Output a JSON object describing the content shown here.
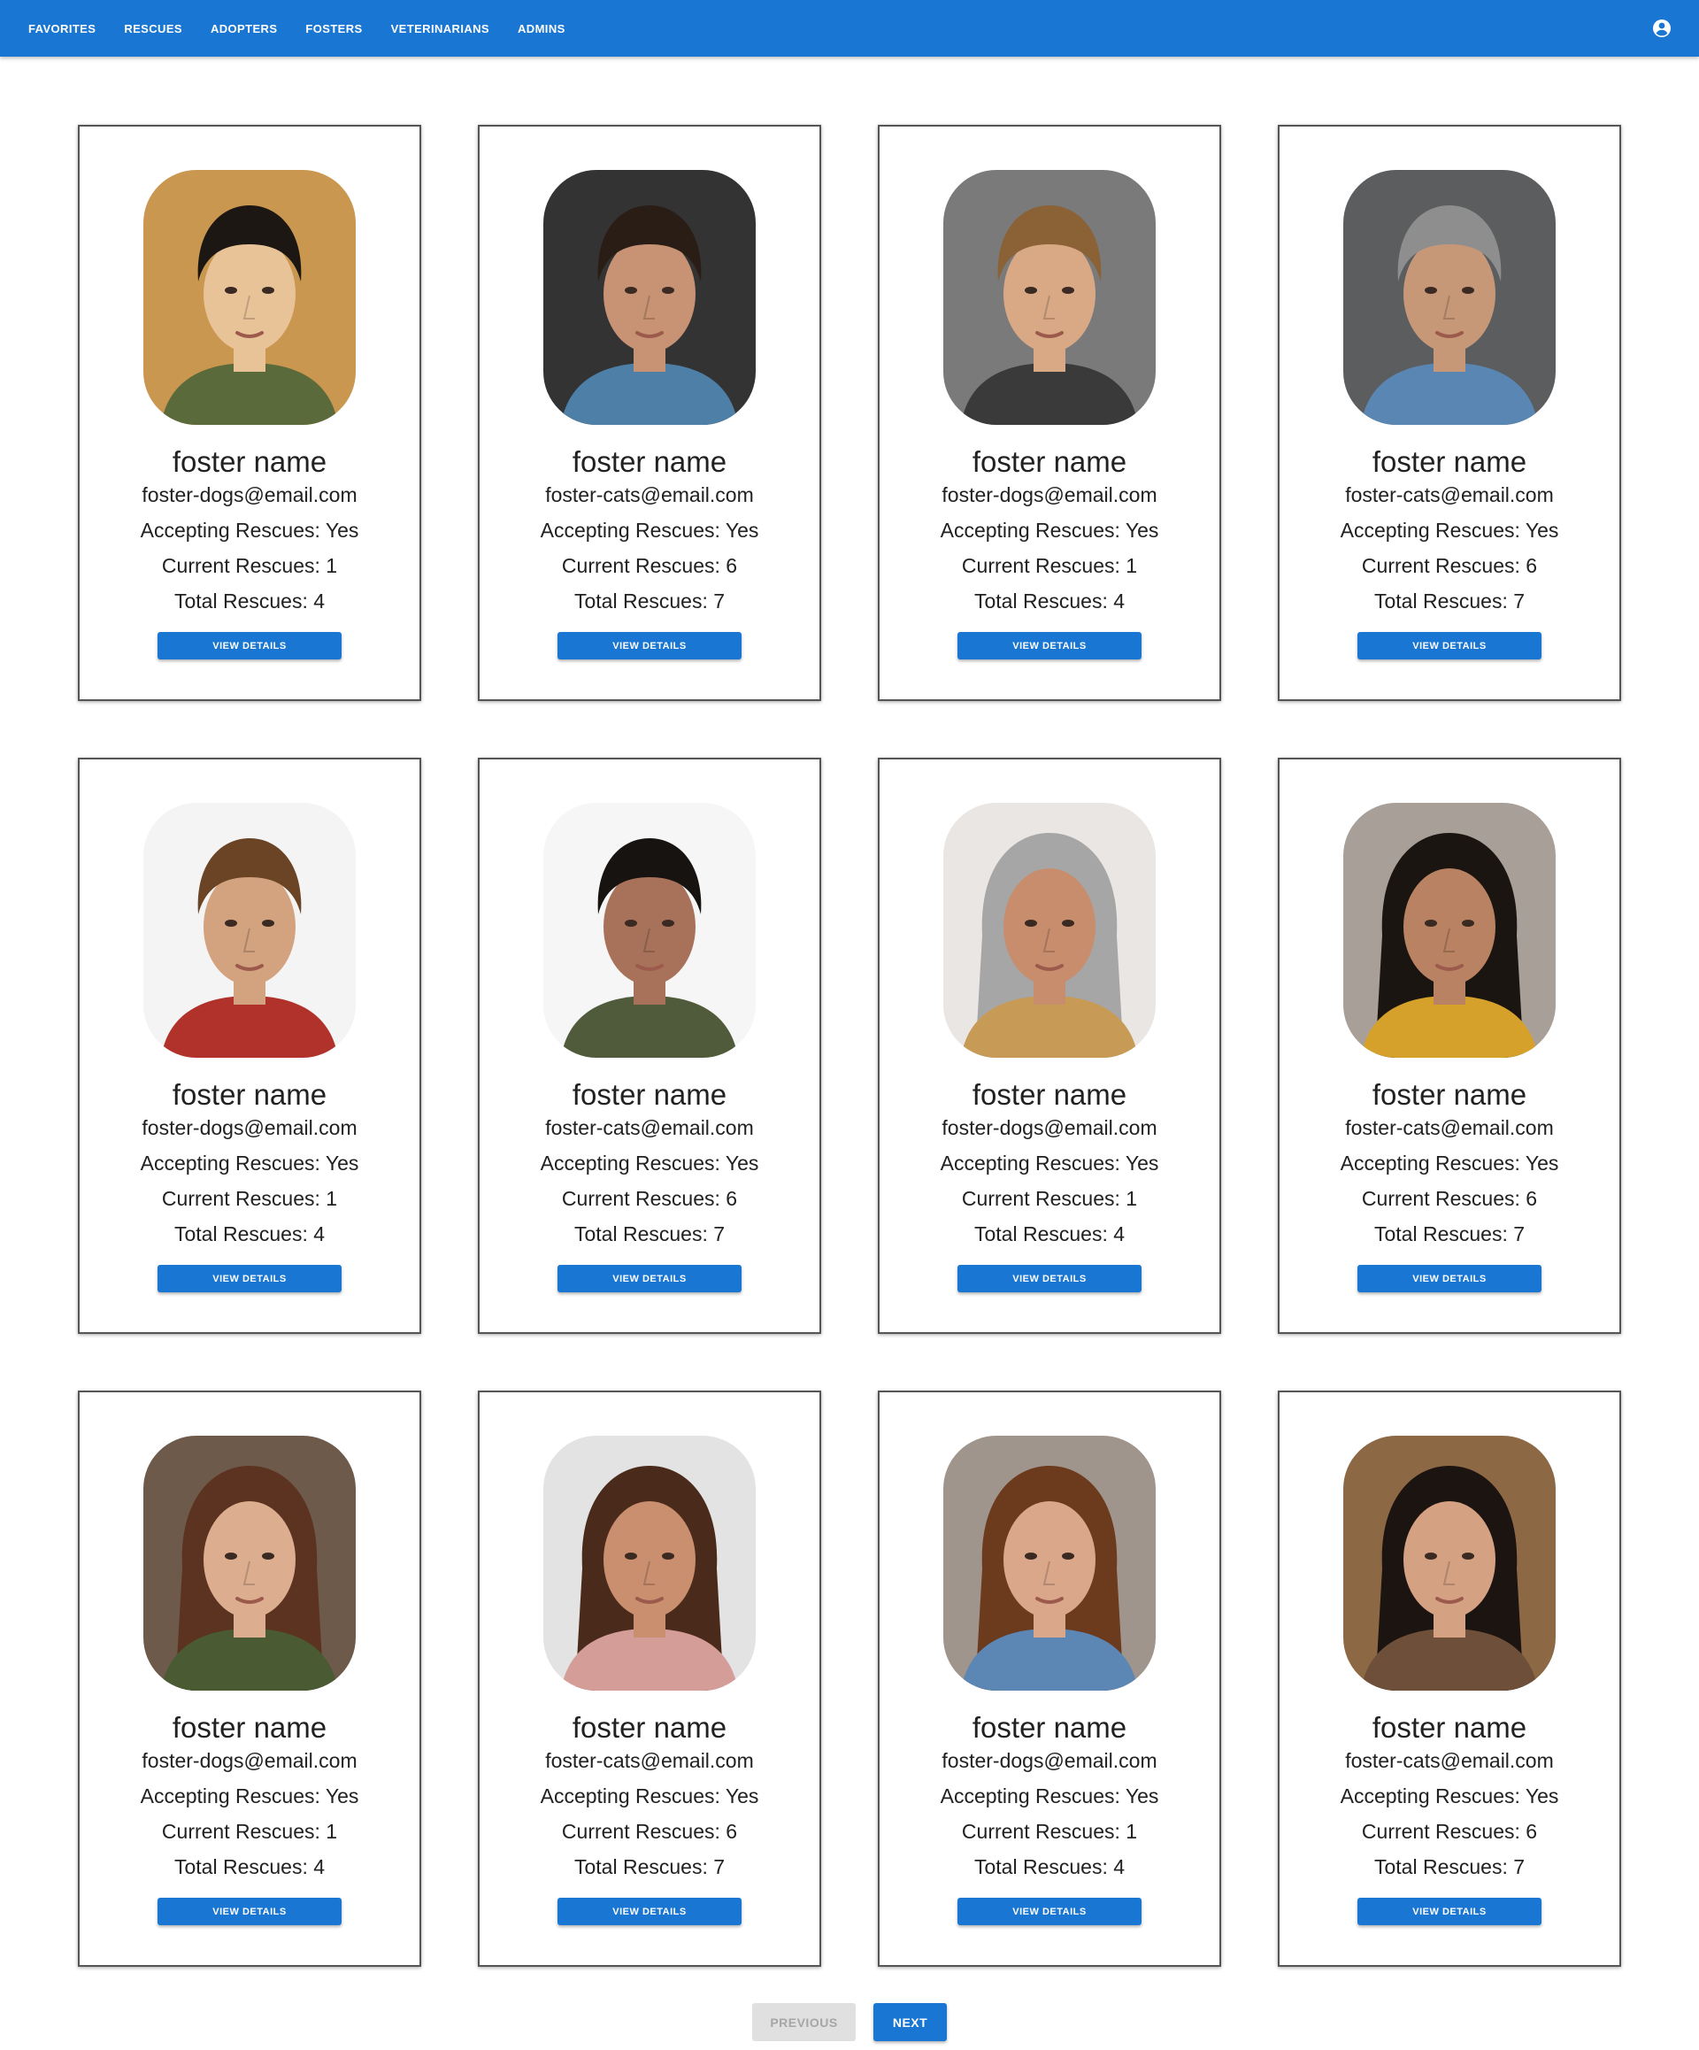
{
  "nav": {
    "items": [
      {
        "label": "FAVORITES"
      },
      {
        "label": "RESCUES"
      },
      {
        "label": "ADOPTERS"
      },
      {
        "label": "FOSTERS"
      },
      {
        "label": "VETERINARIANS"
      },
      {
        "label": "ADMINS"
      }
    ],
    "account_icon": "account-circle-icon"
  },
  "colors": {
    "primary": "#1976d2",
    "disabled_bg": "#e0e0e0",
    "disabled_text": "#a6a6a6"
  },
  "cards": [
    {
      "name": "foster name",
      "email": "foster-dogs@email.com",
      "accepting": "Accepting Rescues: Yes",
      "current": "Current Rescues: 1",
      "total": "Total Rescues: 4",
      "button": "VIEW DETAILS",
      "photo": "portrait-photo"
    },
    {
      "name": "foster name",
      "email": "foster-cats@email.com",
      "accepting": "Accepting Rescues: Yes",
      "current": "Current Rescues: 6",
      "total": "Total Rescues: 7",
      "button": "VIEW DETAILS",
      "photo": "portrait-photo"
    },
    {
      "name": "foster name",
      "email": "foster-dogs@email.com",
      "accepting": "Accepting Rescues: Yes",
      "current": "Current Rescues: 1",
      "total": "Total Rescues: 4",
      "button": "VIEW DETAILS",
      "photo": "portrait-photo"
    },
    {
      "name": "foster name",
      "email": "foster-cats@email.com",
      "accepting": "Accepting Rescues: Yes",
      "current": "Current Rescues: 6",
      "total": "Total Rescues: 7",
      "button": "VIEW DETAILS",
      "photo": "portrait-photo"
    },
    {
      "name": "foster name",
      "email": "foster-dogs@email.com",
      "accepting": "Accepting Rescues: Yes",
      "current": "Current Rescues: 1",
      "total": "Total Rescues: 4",
      "button": "VIEW DETAILS",
      "photo": "portrait-photo"
    },
    {
      "name": "foster name",
      "email": "foster-cats@email.com",
      "accepting": "Accepting Rescues: Yes",
      "current": "Current Rescues: 6",
      "total": "Total Rescues: 7",
      "button": "VIEW DETAILS",
      "photo": "portrait-photo"
    },
    {
      "name": "foster name",
      "email": "foster-dogs@email.com",
      "accepting": "Accepting Rescues: Yes",
      "current": "Current Rescues: 1",
      "total": "Total Rescues: 4",
      "button": "VIEW DETAILS",
      "photo": "portrait-photo"
    },
    {
      "name": "foster name",
      "email": "foster-cats@email.com",
      "accepting": "Accepting Rescues: Yes",
      "current": "Current Rescues: 6",
      "total": "Total Rescues: 7",
      "button": "VIEW DETAILS",
      "photo": "portrait-photo"
    },
    {
      "name": "foster name",
      "email": "foster-dogs@email.com",
      "accepting": "Accepting Rescues: Yes",
      "current": "Current Rescues: 1",
      "total": "Total Rescues: 4",
      "button": "VIEW DETAILS",
      "photo": "portrait-photo"
    },
    {
      "name": "foster name",
      "email": "foster-cats@email.com",
      "accepting": "Accepting Rescues: Yes",
      "current": "Current Rescues: 6",
      "total": "Total Rescues: 7",
      "button": "VIEW DETAILS",
      "photo": "portrait-photo"
    },
    {
      "name": "foster name",
      "email": "foster-dogs@email.com",
      "accepting": "Accepting Rescues: Yes",
      "current": "Current Rescues: 1",
      "total": "Total Rescues: 4",
      "button": "VIEW DETAILS",
      "photo": "portrait-photo"
    },
    {
      "name": "foster name",
      "email": "foster-cats@email.com",
      "accepting": "Accepting Rescues: Yes",
      "current": "Current Rescues: 6",
      "total": "Total Rescues: 7",
      "button": "VIEW DETAILS",
      "photo": "portrait-photo"
    }
  ],
  "pagination": {
    "previous_label": "PREVIOUS",
    "previous_disabled": true,
    "next_label": "NEXT"
  }
}
